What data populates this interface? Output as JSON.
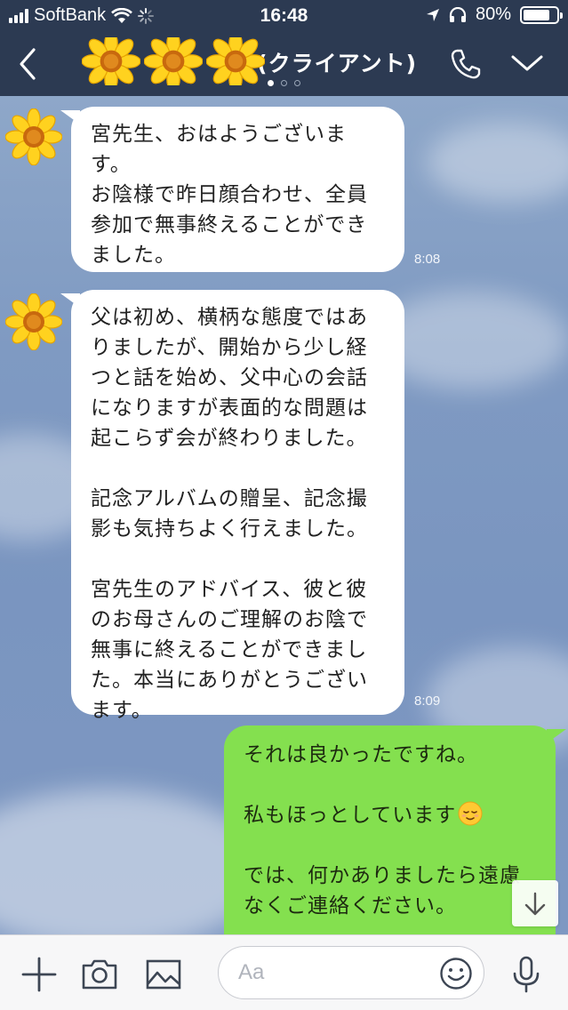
{
  "status_bar": {
    "carrier": "SoftBank",
    "time": "16:48",
    "battery_percent": "80%",
    "battery_level": 0.8
  },
  "header": {
    "title": "(クライアント)",
    "page_indicator": {
      "pages": 3,
      "active": 1
    }
  },
  "messages": [
    {
      "direction": "incoming",
      "text": "宮先生、おはようございま\nす。\nお陰様で昨日顔合わせ、全員\n参加で無事終えることができ\nました。",
      "time": "8:08"
    },
    {
      "direction": "incoming",
      "text": "父は初め、横柄な態度ではあ\nりましたが、開始から少し経\nつと話を始め、父中心の会話\nになりますが表面的な問題は\n起こらず会が終わりました。\n\n記念アルバムの贈呈、記念撮\n影も気持ちよく行えました。\n\n宮先生のアドバイス、彼と彼\nのお母さんのご理解のお陰で\n無事に終えることができまし\nた。本当にありがとうござい\nます。",
      "time": "8:09"
    },
    {
      "direction": "outgoing",
      "line1": "それは良かったですね。",
      "line2": "私もほっとしています",
      "line3": "では、何かありましたら遠慮\nなくご連絡ください。"
    }
  ],
  "input": {
    "placeholder": "Aa"
  },
  "icons": {
    "back": "back-chevron-icon",
    "call": "phone-icon",
    "menu": "chevron-down-icon",
    "avatar": "sunflower-avatar-icon",
    "plus": "plus-icon",
    "camera": "camera-icon",
    "image": "image-icon",
    "emoji": "smiley-icon",
    "mic": "microphone-icon",
    "scroll": "arrow-down-icon"
  },
  "colors": {
    "header": "#2c3a52",
    "outgoing_bubble": "#84e04f",
    "incoming_bubble": "#ffffff",
    "chat_background": "#7f9ac2"
  }
}
